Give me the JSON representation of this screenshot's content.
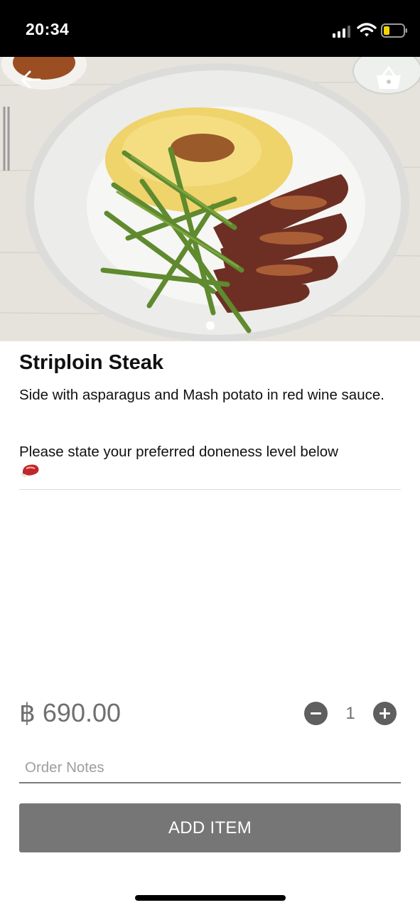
{
  "status_bar": {
    "time": "20:34",
    "icons": [
      "signal-icon",
      "wifi-icon",
      "battery-icon"
    ]
  },
  "hero": {
    "icons": [
      "back-arrow-icon",
      "basket-icon"
    ],
    "pager": {
      "current": 1,
      "total": 1
    }
  },
  "item": {
    "title": "Striploin Steak",
    "description": "Side with asparagus and Mash potato in red wine sauce.",
    "note": "Please state your preferred doneness level below",
    "note_icon": "cut-of-meat-icon"
  },
  "order": {
    "price": "฿ 690.00",
    "quantity": "1",
    "notes_placeholder": "Order Notes",
    "add_label": "ADD ITEM"
  },
  "colors": {
    "button": "#767676",
    "price_text": "#6f6f6f",
    "stepper": "#5f5f5f",
    "battery_low": "#f5d300"
  }
}
